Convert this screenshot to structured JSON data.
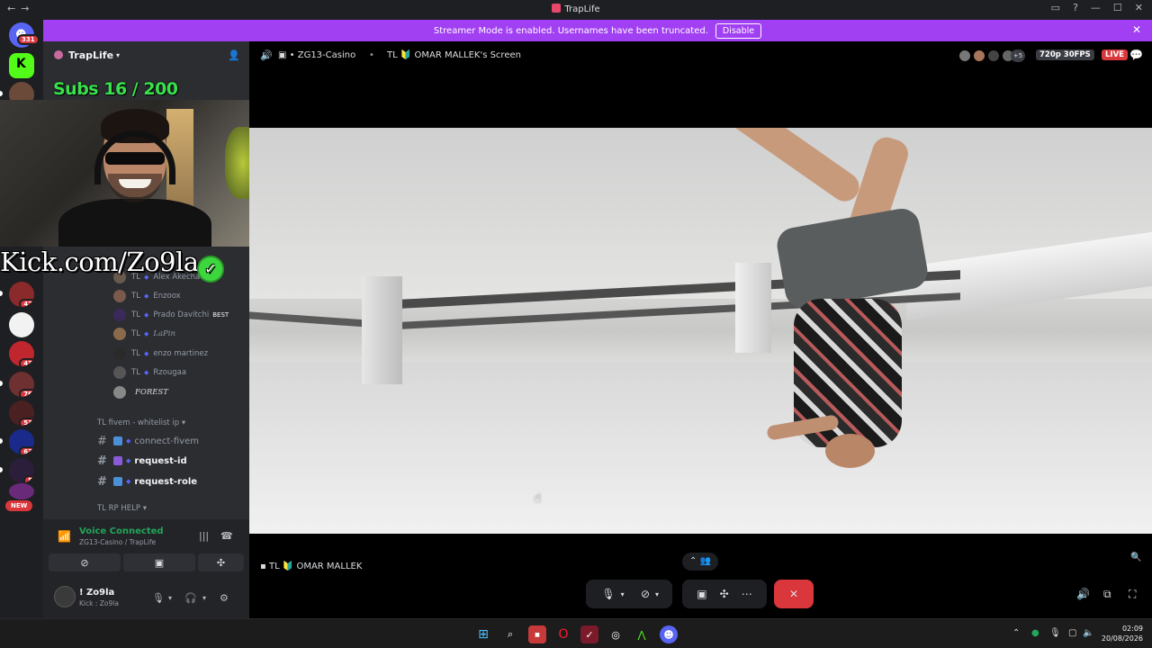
{
  "titlebar": {
    "title": "TrapLife",
    "back": "←",
    "forward": "→"
  },
  "banner": {
    "text": "Streamer Mode is enabled. Usernames have been truncated.",
    "button": "Disable",
    "close": "✕"
  },
  "guilds": {
    "home_badge": "331",
    "badges": [
      "42",
      "43",
      "76",
      "53",
      "63",
      "5"
    ],
    "new_label": "NEW"
  },
  "server": {
    "name": "TrapLife"
  },
  "overlay": {
    "subs": "Subs 16 / 200",
    "kick": "Kick.com/Zo9la"
  },
  "voice_users": [
    {
      "tl": "TL",
      "name": "Alex Akecha",
      "badge": "TL"
    },
    {
      "tl": "TL",
      "name": "Enzoox",
      "badge": ""
    },
    {
      "tl": "TL",
      "name": "Prado Davitchi",
      "badge": "BEST"
    },
    {
      "tl": "TL",
      "name": "LaPin",
      "badge": ""
    },
    {
      "tl": "TL",
      "name": "enzo martinez",
      "badge": ""
    },
    {
      "tl": "TL",
      "name": "Rzougaa",
      "badge": ""
    },
    {
      "tl": "",
      "name": "FOREST",
      "badge": ""
    }
  ],
  "categories": {
    "fivem": "TL fivem - whitelist ip",
    "rp_help": "TL RP HELP"
  },
  "text_channels": [
    {
      "name": "connect-fivem",
      "style": "dim"
    },
    {
      "name": "request-id",
      "style": "bold"
    },
    {
      "name": "request-role",
      "style": "bold"
    }
  ],
  "voice_panel": {
    "status": "Voice Connected",
    "location": "ZG13-Casino / TrapLife",
    "username": "! Zo9la",
    "user_status": "Kick : Zo9la"
  },
  "stage": {
    "channel": "ZG13-Casino",
    "screen_title": "TL 🔰 OMAR MALLEK's Screen",
    "extra_count": "+5",
    "quality": "720p 30FPS",
    "live": "LIVE",
    "footer_name": "TL 🔰 OMAR MALLEK"
  },
  "taskbar": {
    "time": "02:09",
    "date": "20/08/2026"
  }
}
